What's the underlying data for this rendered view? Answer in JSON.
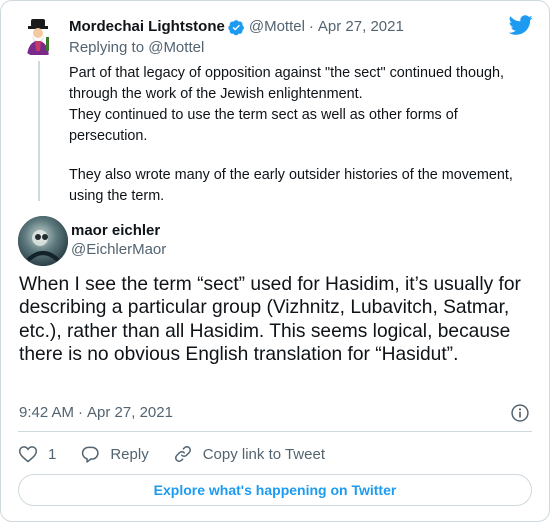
{
  "colors": {
    "accent": "#1d9bf0",
    "text": "#0f1419",
    "muted": "#536471",
    "border": "#cfd9de"
  },
  "icons": {
    "brand": "twitter-bird-icon",
    "verified": "verified-badge-icon",
    "info": "info-icon",
    "like": "heart-icon",
    "reply": "reply-bubble-icon",
    "copy": "link-icon"
  },
  "parent_tweet": {
    "author_name": "Mordechai Lightstone",
    "handle": "@Mottel",
    "separator": "·",
    "date": "Apr 27, 2021",
    "replying_to": "Replying to @Mottel",
    "paragraph1_line1": "Part of that legacy of opposition against \"the sect\" continued though,",
    "paragraph1_line2": "through the work of the Jewish enlightenment.",
    "paragraph2": "They continued to use the term sect as well as other forms of persecution.",
    "paragraph3": "They also wrote many of the early outsider histories of the movement, using the term."
  },
  "main_tweet": {
    "author_name": "maor eichler",
    "handle": "@EichlerMaor",
    "text": "When I see the term “sect” used for Hasidim, it’s usually for describing a particular group (Vizhnitz, Lubavitch, Satmar, etc.), rather than all Hasidim. This seems logical, because there is no obvious English translation for “Hasidut”.",
    "time": "9:42 AM",
    "separator": "·",
    "date": "Apr 27, 2021"
  },
  "actions": {
    "like_count": "1",
    "reply_label": "Reply",
    "copy_label": "Copy link to Tweet"
  },
  "explore_label": "Explore what's happening on Twitter"
}
